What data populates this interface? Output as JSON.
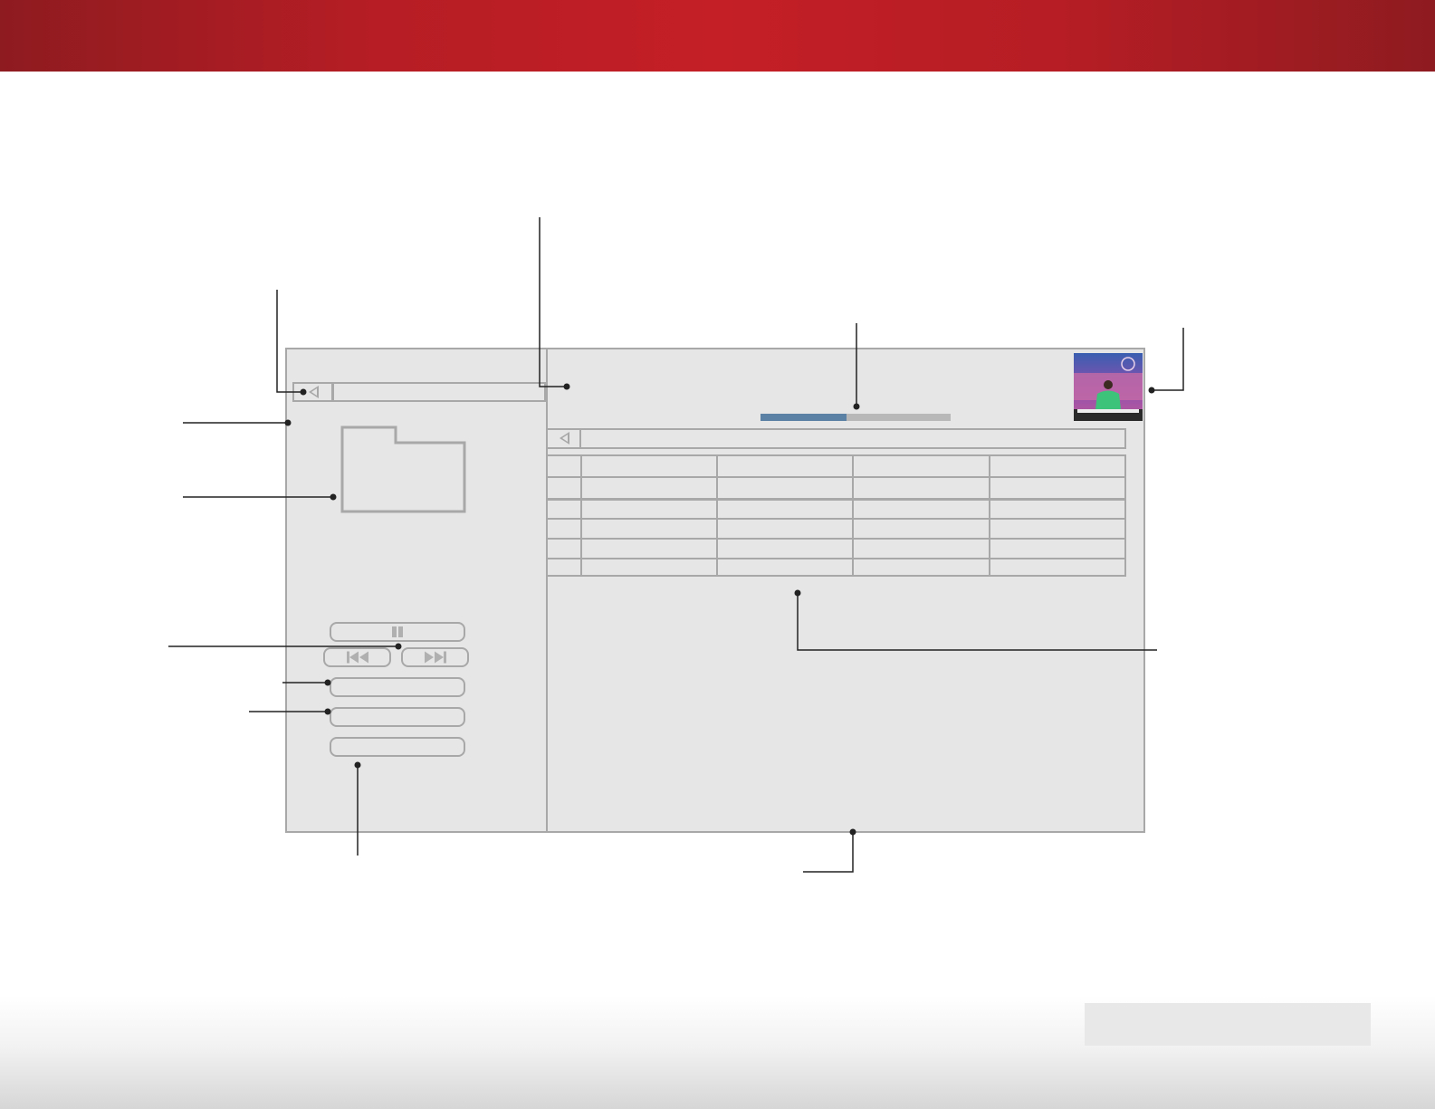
{
  "colors": {
    "header": "#c41f27",
    "panel": "#e6e6e6",
    "outline": "#a8a8a8",
    "progress_fill": "#5b82a4",
    "progress_track": "#b8b8b8",
    "callout": "#222222"
  },
  "playback": {
    "progress_fraction": 0.45
  },
  "left_panel": {
    "path_back_icon": "back-triangle-icon",
    "folder_icon": "folder-icon",
    "controls": [
      {
        "name": "pause-button",
        "icon": "pause-icon"
      },
      {
        "name": "previous-button",
        "icon": "skip-back-icon"
      },
      {
        "name": "next-button",
        "icon": "skip-forward-icon"
      },
      {
        "name": "option-button-1",
        "icon": ""
      },
      {
        "name": "option-button-2",
        "icon": ""
      },
      {
        "name": "option-button-3",
        "icon": ""
      }
    ]
  },
  "right_panel": {
    "thumbnail_icon": "album-art-thumbnail",
    "list_back_icon": "back-triangle-icon",
    "table": {
      "rows": 6,
      "columns": 5
    }
  },
  "callout_count": 12
}
